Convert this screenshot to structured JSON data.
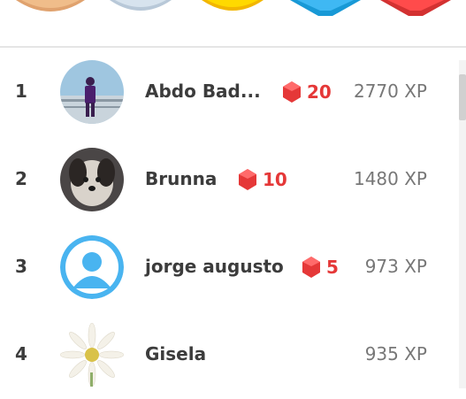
{
  "league_badges": [
    "bronze-league-icon",
    "silver-league-icon",
    "gold-league-icon",
    "sapphire-league-icon",
    "ruby-league-icon"
  ],
  "colors": {
    "gem": "#e53838",
    "text": "#3c3c3c",
    "xp": "#777777"
  },
  "leaderboard": [
    {
      "rank": "1",
      "name": "Abdo Bad...",
      "gems": "20",
      "xp": "2770 XP",
      "avatar": "avatar-photo-person"
    },
    {
      "rank": "2",
      "name": "Brunna",
      "gems": "10",
      "xp": "1480 XP",
      "avatar": "avatar-photo-dog"
    },
    {
      "rank": "3",
      "name": "jorge augusto",
      "gems": "5",
      "xp": "973 XP",
      "avatar": "avatar-default-silhouette"
    },
    {
      "rank": "4",
      "name": "Gisela",
      "gems": "",
      "xp": "935 XP",
      "avatar": "avatar-photo-flower"
    }
  ]
}
